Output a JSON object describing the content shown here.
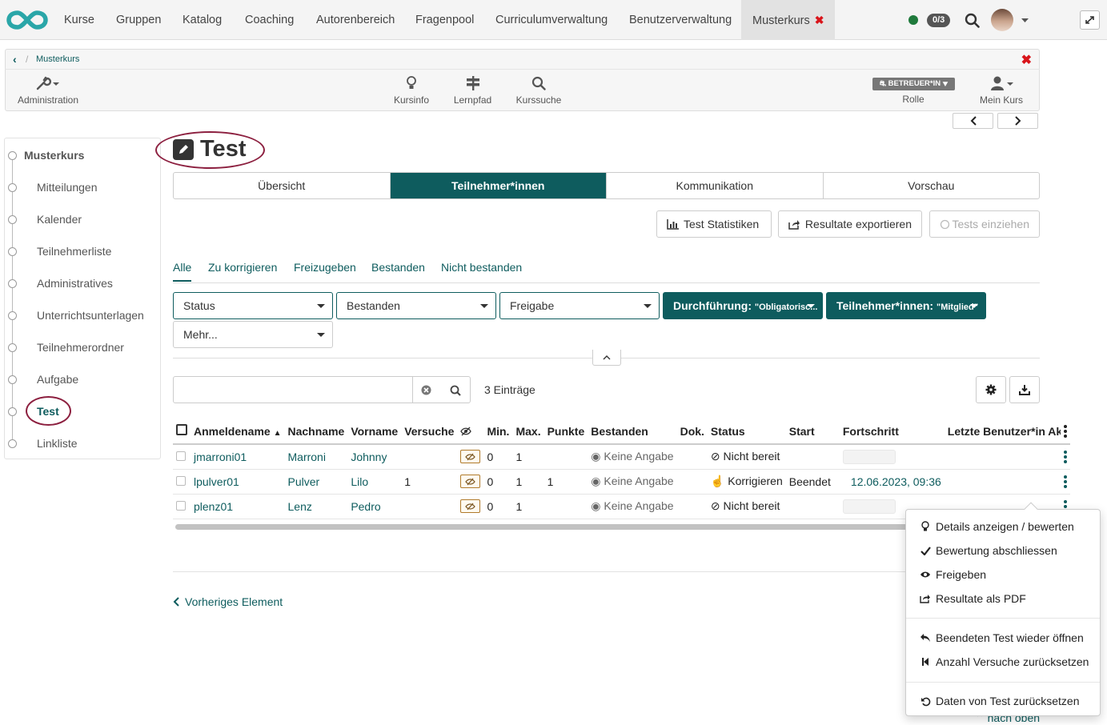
{
  "topnav": {
    "items": [
      "Kurse",
      "Gruppen",
      "Katalog",
      "Coaching",
      "Autorenbereich",
      "Fragenpool",
      "Curriculumverwaltung",
      "Benutzerverwaltung"
    ],
    "active_tab": "Musterkurs",
    "badge": "0/3"
  },
  "course": {
    "breadcrumb": "Musterkurs",
    "tools": {
      "admin": "Administration",
      "info": "Kursinfo",
      "path": "Lernpfad",
      "search": "Kurssuche",
      "role_button": "BETREUER*IN",
      "role": "Rolle",
      "mycourse": "Mein Kurs"
    }
  },
  "menu": {
    "root": "Musterkurs",
    "items": [
      "Mitteilungen",
      "Kalender",
      "Teilnehmerliste",
      "Administratives",
      "Unterrichtsunterlagen",
      "Teilnehmerordner",
      "Aufgabe",
      "Test",
      "Linkliste"
    ]
  },
  "page": {
    "title": "Test",
    "tabs": [
      "Übersicht",
      "Teilnehmer*innen",
      "Kommunikation",
      "Vorschau"
    ],
    "actions": {
      "stats": "Test Statistiken",
      "export": "Resultate exportieren",
      "collect": "Tests einziehen"
    },
    "subtabs": [
      "Alle",
      "Zu korrigieren",
      "Freizugeben",
      "Bestanden",
      "Nicht bestanden"
    ],
    "filters": {
      "status": "Status",
      "passed": "Bestanden",
      "release": "Freigabe",
      "exec_label": "Durchführung: ",
      "exec_value": "\"Obligatorisc...",
      "part_label": "Teilnehmer*innen: ",
      "part_value": "\"Mitglied\"",
      "more": "Mehr..."
    },
    "entries": "3 Einträge"
  },
  "table": {
    "headers": [
      "Anmeldename",
      "Nachname",
      "Vorname",
      "Versuche",
      "Min.",
      "Max.",
      "Punkte",
      "Bestanden",
      "Dok.",
      "Status",
      "Start",
      "Fortschritt",
      "Letzte Benutzer*in Akt"
    ],
    "rows": [
      {
        "login": "jmarroni01",
        "last": "Marroni",
        "first": "Johnny",
        "attempts": "",
        "min": "0",
        "max": "1",
        "points": "",
        "passed": "Keine Angabe",
        "status": "Nicht bereit",
        "start": "",
        "progress": "",
        "lastact": ""
      },
      {
        "login": "lpulver01",
        "last": "Pulver",
        "first": "Lilo",
        "attempts": "1",
        "min": "0",
        "max": "1",
        "points": "1",
        "passed": "Keine Angabe",
        "status": "Korrigieren",
        "start": "Beendet",
        "progress": "12.06.2023, 09:36",
        "lastact": ""
      },
      {
        "login": "plenz01",
        "last": "Lenz",
        "first": "Pedro",
        "attempts": "",
        "min": "0",
        "max": "1",
        "points": "",
        "passed": "Keine Angabe",
        "status": "Nicht bereit",
        "start": "",
        "progress": "",
        "lastact": ""
      }
    ]
  },
  "footer": {
    "prev": "Vorheriges Element",
    "top": "nach oben"
  },
  "dropdown": {
    "items": [
      "Details anzeigen / bewerten",
      "Bewertung abschliessen",
      "Freigeben",
      "Resultate als PDF",
      "Beendeten Test wieder öffnen",
      "Anzahl Versuche zurücksetzen",
      "Daten von Test zurücksetzen"
    ]
  },
  "colors": {
    "accent": "#0e5c5e",
    "close": "#d9151b",
    "highlight_ring": "#8c1f3f"
  }
}
